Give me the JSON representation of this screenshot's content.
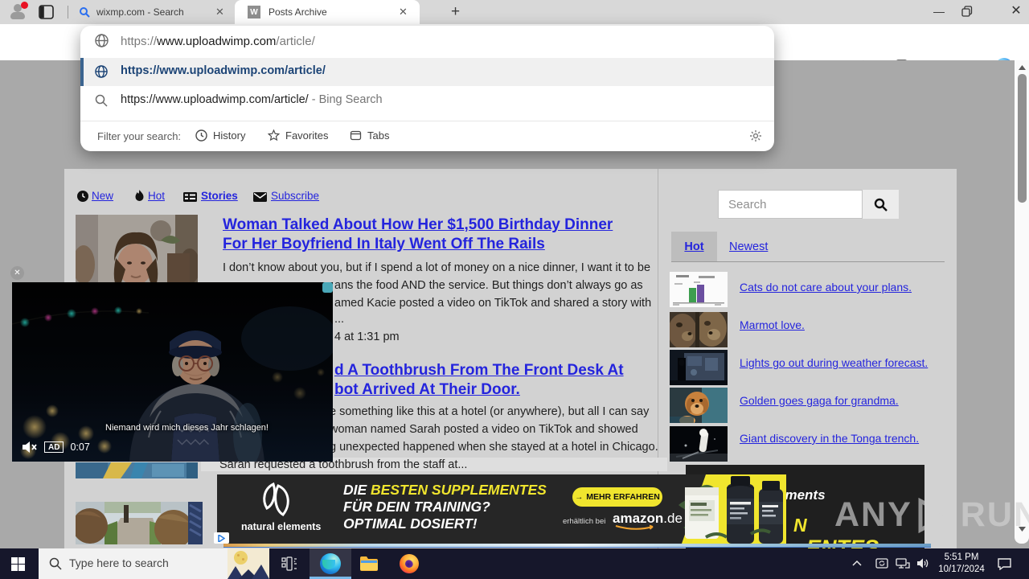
{
  "browser": {
    "tabs": [
      {
        "title": "wixmp.com - Search"
      },
      {
        "title": "Posts Archive"
      }
    ],
    "address": {
      "protocol": "https://",
      "host": "www.uploadwimp.com",
      "path": "/article/"
    },
    "omnibox": {
      "url_suggestion": "https://www.uploadwimp.com/article/",
      "search_suggestion": "https://www.uploadwimp.com/article/",
      "search_suffix": " - Bing Search",
      "filter_label": "Filter your search:",
      "filters": [
        {
          "label": "History"
        },
        {
          "label": "Favorites"
        },
        {
          "label": "Tabs"
        }
      ]
    }
  },
  "page": {
    "nav": [
      {
        "label": "New"
      },
      {
        "label": "Hot"
      },
      {
        "label": "Stories"
      },
      {
        "label": "Subscribe"
      }
    ],
    "article1": {
      "title": "Woman Talked About How Her $1,500 Birthday Dinner For Her Boyfriend In Italy Went Off The Rails",
      "lines": [
        "I don’t know about you, but if I spend a lot of money on a nice dinner, I want it to be",
        "ans the food AND the service. But things don’t always go as",
        "amed Kacie posted a video on TikTok and shared a story with",
        "..."
      ],
      "meta": "4 at 1:31 pm"
    },
    "article2": {
      "title_line1": "d A Toothbrush From The Front Desk At",
      "title_line2": "bot Arrived At Their Door.",
      "lines": [
        "e something like this at a hotel (or anywhere), but all I can say",
        "woman named Sarah posted a video on TikTok and showed",
        "g unexpected happened when she stayed at a hotel in Chicago.",
        "Sarah requested a toothbrush from the staff at..."
      ]
    },
    "sidebar": {
      "search_placeholder": "Search",
      "tabs": [
        {
          "label": "Hot"
        },
        {
          "label": "Newest"
        }
      ],
      "items": [
        {
          "label": "Cats do not care about your plans."
        },
        {
          "label": "Marmot love."
        },
        {
          "label": "Lights go out during weather forecast."
        },
        {
          "label": "Golden goes gaga for grandma."
        },
        {
          "label": "Giant discovery in the Tonga trench."
        }
      ]
    },
    "video_ad": {
      "caption": "Niemand wird mich dieses Jahr schlagen!",
      "badge": "AD",
      "time": "0:07"
    },
    "banner_ad": {
      "brand": "natural elements",
      "headline_white": "DIE ",
      "headline_yellow": "BESTEN SUPPLEMENTES",
      "line2": "FÜR DEIN TRAINING?",
      "line3": "OPTIMAL DOSIERT!",
      "cta": "MEHR ERFAHREN",
      "availability": "erhältlich bei",
      "retailer": "amazon",
      "retailer_tld": ".de"
    },
    "right_ad": {
      "text_top": "ements",
      "text_mid": "N",
      "text_bottom": "ENTES FÜR"
    },
    "watermark": {
      "left": "ANY",
      "right": "RUN"
    }
  },
  "taskbar": {
    "search_placeholder": "Type here to search",
    "time": "5:51 PM",
    "date": "10/17/2024"
  }
}
